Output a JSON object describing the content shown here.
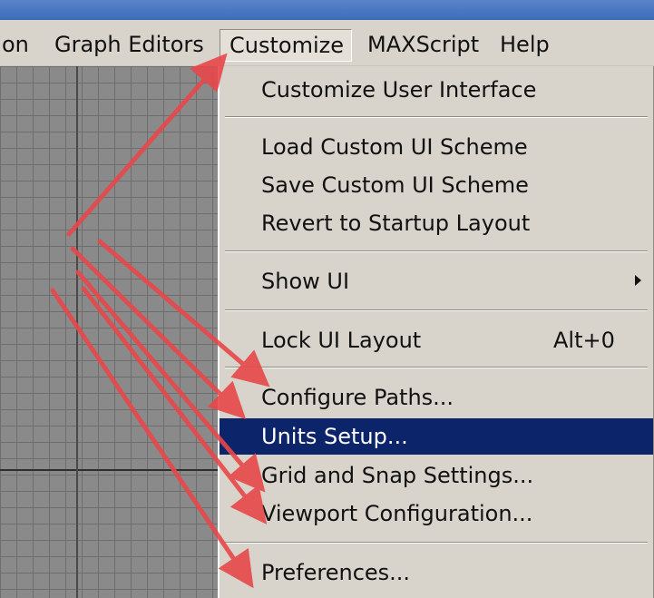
{
  "menubar": {
    "items": [
      {
        "label": "on"
      },
      {
        "label": "Graph Editors"
      },
      {
        "label": "Customize"
      },
      {
        "label": "MAXScript"
      },
      {
        "label": "Help"
      }
    ]
  },
  "customize_menu": {
    "items": [
      {
        "label": "Customize User Interface"
      },
      {
        "label": "Load Custom UI Scheme"
      },
      {
        "label": "Save Custom UI Scheme"
      },
      {
        "label": "Revert to Startup Layout"
      },
      {
        "label": "Show UI",
        "submenu": true
      },
      {
        "label": "Lock UI Layout",
        "shortcut": "Alt+0"
      },
      {
        "label": "Configure Paths..."
      },
      {
        "label": "Units Setup...",
        "highlighted": true
      },
      {
        "label": "Grid and Snap Settings..."
      },
      {
        "label": "Viewport Configuration..."
      },
      {
        "label": "Preferences..."
      }
    ]
  },
  "colors": {
    "menu_bg": "#d8d4cc",
    "highlight_bg": "#0c246a",
    "annotation_arrow": "#e8484a"
  }
}
